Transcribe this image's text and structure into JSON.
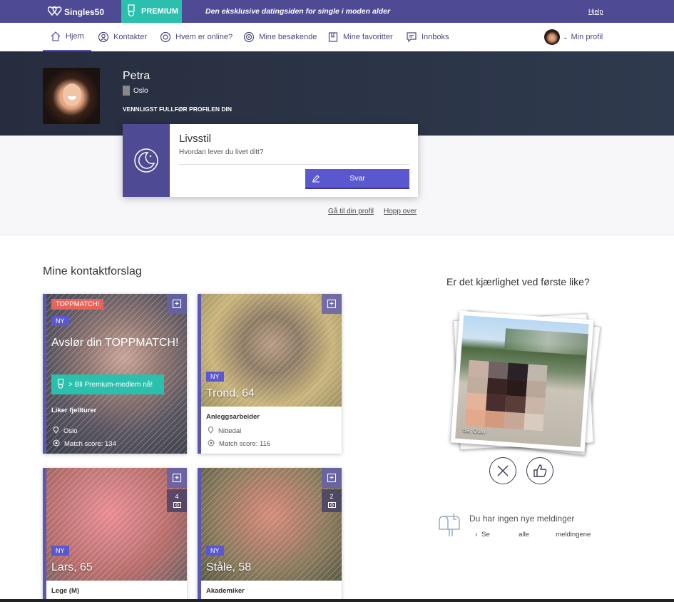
{
  "topbar": {
    "logo": "Singles50",
    "premium": "PREMIUM",
    "tagline": "Den eksklusive datingsiden for single i moden alder",
    "help": "Hjelp"
  },
  "nav": {
    "items": [
      {
        "label": "Hjem",
        "icon": "home-icon"
      },
      {
        "label": "Kontakter",
        "icon": "contacts-icon"
      },
      {
        "label": "Hvem er online?",
        "icon": "online-icon"
      },
      {
        "label": "Mine besøkende",
        "icon": "visitors-icon"
      },
      {
        "label": "Mine favoritter",
        "icon": "favorites-icon"
      },
      {
        "label": "Innboks",
        "icon": "inbox-icon"
      }
    ],
    "profile": "Min profil"
  },
  "profile": {
    "name": "Petra",
    "city": "Oslo",
    "complete_prompt": "VENNLIGST FULLFØR PROFILEN DIN"
  },
  "question": {
    "title": "Livsstil",
    "subtitle": "Hvordan lever du livet ditt?",
    "button": "Svar",
    "go_profile": "Gå til din profil",
    "skip": "Hopp over"
  },
  "suggestions": {
    "title": "Mine kontaktforslag",
    "topmatch": {
      "badge": "TOPPMATCH!",
      "new": "NY",
      "headline": "Avslør din TOPPMATCH!",
      "premium_button": "> Bli Premium-medlem nå!",
      "job": "Liker fjellturer",
      "city": "Oslo",
      "score": "Match score: 134"
    },
    "cards": [
      {
        "new": "NY",
        "name": "Trond, 64",
        "job": "Anleggsarbeider",
        "city": "Nittedal",
        "score": "Match score: 116"
      },
      {
        "new": "NY",
        "name": "Lars, 65",
        "job": "Lege (M)",
        "photos": "4"
      },
      {
        "new": "NY",
        "name": "Ståle, 58",
        "job": "Akademiker",
        "photos": "2"
      }
    ]
  },
  "love": {
    "title": "Er det kjærlighet ved første like?",
    "caption": "59, Oslo"
  },
  "messages": {
    "text": "Du har ingen nye meldinger",
    "link_a": "Se",
    "link_b": "alle",
    "link_c": "meldingene"
  },
  "colors": {
    "topbar": "#4e4a93",
    "premium": "#2bbfae",
    "accent": "#5b57cf",
    "hero": "#2b3245",
    "topmatch": "#e8645a"
  }
}
